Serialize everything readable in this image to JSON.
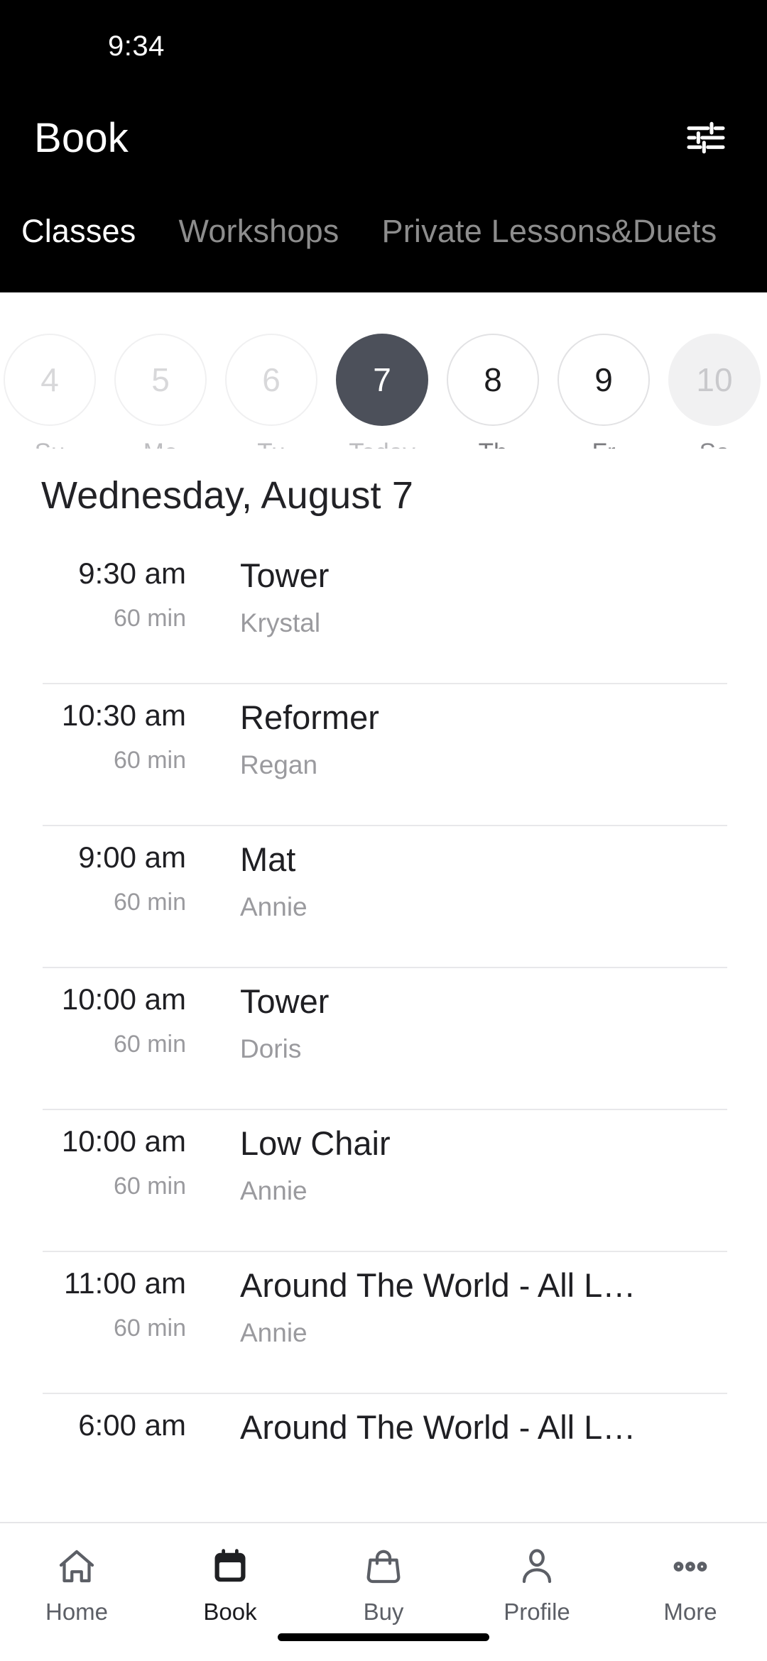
{
  "status_bar": {
    "time": "9:34"
  },
  "header": {
    "title": "Book",
    "filter_icon": "tune-sliders-icon",
    "background_color": "#000000",
    "tabs": [
      {
        "label": "Classes",
        "active": true
      },
      {
        "label": "Workshops",
        "active": false
      },
      {
        "label": "Private Lessons&Duets",
        "active": false
      }
    ]
  },
  "date_strip": {
    "days": [
      {
        "num": "4",
        "label": "Su",
        "state": "past"
      },
      {
        "num": "5",
        "label": "Mo",
        "state": "past"
      },
      {
        "num": "6",
        "label": "Tu",
        "state": "past"
      },
      {
        "num": "7",
        "label": "Today",
        "state": "selected"
      },
      {
        "num": "8",
        "label": "Th",
        "state": "normal"
      },
      {
        "num": "9",
        "label": "Fr",
        "state": "normal"
      },
      {
        "num": "10",
        "label": "Sa",
        "state": "muted"
      }
    ],
    "selected_color": "#4c505a"
  },
  "date_heading": "Wednesday, August 7",
  "classes": [
    {
      "time": "9:30 am",
      "duration": "60 min",
      "name": "Tower",
      "instructor": "Krystal"
    },
    {
      "time": "10:30 am",
      "duration": "60 min",
      "name": "Reformer",
      "instructor": "Regan"
    },
    {
      "time": "9:00 am",
      "duration": "60 min",
      "name": "Mat",
      "instructor": "Annie"
    },
    {
      "time": "10:00 am",
      "duration": "60 min",
      "name": "Tower",
      "instructor": "Doris"
    },
    {
      "time": "10:00 am",
      "duration": "60 min",
      "name": "Low Chair",
      "instructor": "Annie"
    },
    {
      "time": "11:00 am",
      "duration": "60 min",
      "name": "Around The World - All L…",
      "instructor": "Annie"
    },
    {
      "time": "6:00 am",
      "duration": "",
      "name": "Around The World - All L…",
      "instructor": ""
    }
  ],
  "bottom_nav": {
    "items": [
      {
        "label": "Home",
        "icon": "home-icon",
        "active": false
      },
      {
        "label": "Book",
        "icon": "calendar-icon",
        "active": true
      },
      {
        "label": "Buy",
        "icon": "shopping-bag-icon",
        "active": false
      },
      {
        "label": "Profile",
        "icon": "person-icon",
        "active": false
      },
      {
        "label": "More",
        "icon": "three-dots-icon",
        "active": false
      }
    ]
  }
}
